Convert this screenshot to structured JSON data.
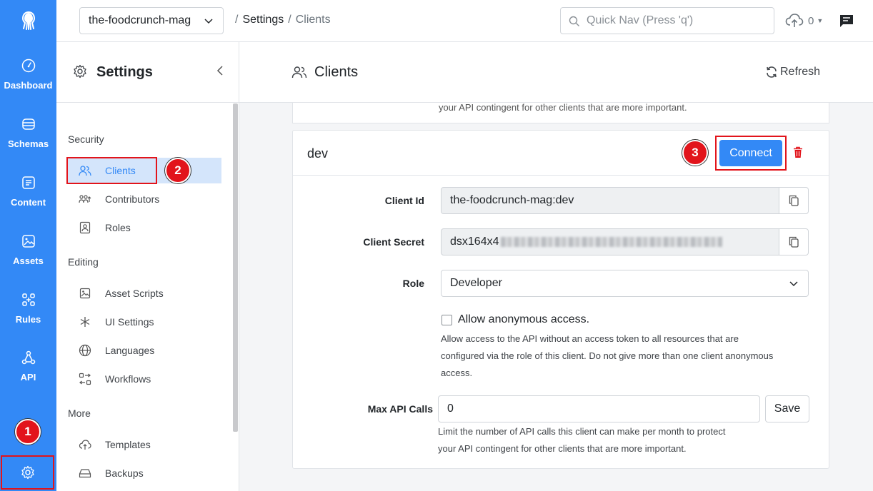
{
  "nav": {
    "items": [
      {
        "label": "Dashboard",
        "icon": "gauge-icon"
      },
      {
        "label": "Schemas",
        "icon": "database-icon"
      },
      {
        "label": "Content",
        "icon": "content-icon"
      },
      {
        "label": "Assets",
        "icon": "image-icon"
      },
      {
        "label": "Rules",
        "icon": "rules-icon"
      },
      {
        "label": "API",
        "icon": "api-icon"
      }
    ],
    "accent": "#3389f6"
  },
  "topbar": {
    "app_name": "the-foodcrunch-mag",
    "crumb_settings": "Settings",
    "crumb_current": "Clients",
    "quicknav_placeholder": "Quick Nav (Press 'q')",
    "upload_count": "0"
  },
  "settings_panel": {
    "title": "Settings",
    "groups": {
      "security": "Security",
      "editing": "Editing",
      "more": "More"
    },
    "items": {
      "clients": "Clients",
      "contributors": "Contributors",
      "roles": "Roles",
      "asset_scripts": "Asset Scripts",
      "ui_settings": "UI Settings",
      "languages": "Languages",
      "workflows": "Workflows",
      "templates": "Templates",
      "backups": "Backups"
    }
  },
  "main": {
    "title": "Clients",
    "refresh_label": "Refresh",
    "prev_card_text": "your API contingent for other clients that are more important.",
    "client": {
      "name": "dev",
      "connect_label": "Connect",
      "client_id_label": "Client Id",
      "client_id_value": "the-foodcrunch-mag:dev",
      "client_secret_label": "Client Secret",
      "client_secret_visible": "dsx164x4",
      "role_label": "Role",
      "role_value": "Developer",
      "anonymous_label": "Allow anonymous access.",
      "anonymous_checked": false,
      "anonymous_help_1": "Allow access to the API without an access token to all resources that are",
      "anonymous_help_2": "configured via the role of this client. Do not give more than one client anonymous",
      "anonymous_help_3": "access.",
      "max_calls_label": "Max API Calls",
      "max_calls_value": "0",
      "save_label": "Save",
      "max_calls_help_1": "Limit the number of API calls this client can make per month to protect",
      "max_calls_help_2": "your API contingent for other clients that are more important."
    }
  },
  "annotations": {
    "step1": "1",
    "step2": "2",
    "step3": "3",
    "color": "#e2141b"
  }
}
